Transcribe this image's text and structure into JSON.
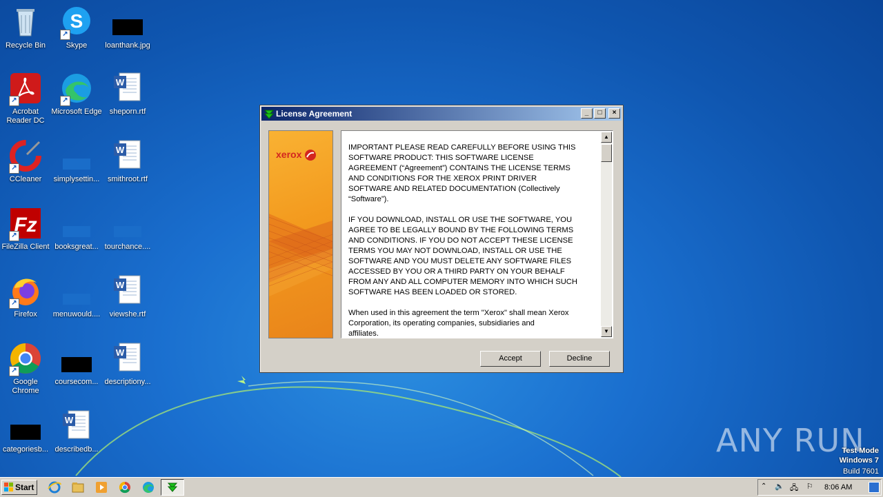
{
  "desktop": {
    "icons": [
      {
        "label": "Recycle Bin"
      },
      {
        "label": "Skype"
      },
      {
        "label": "loanthank.jpg"
      },
      {
        "label": "Acrobat Reader DC"
      },
      {
        "label": "Microsoft Edge"
      },
      {
        "label": "sheporn.rtf"
      },
      {
        "label": "CCleaner"
      },
      {
        "label": "simplysettin..."
      },
      {
        "label": "smithroot.rtf"
      },
      {
        "label": "FileZilla Client"
      },
      {
        "label": "booksgreat..."
      },
      {
        "label": "tourchance...."
      },
      {
        "label": "Firefox"
      },
      {
        "label": "menuwould...."
      },
      {
        "label": "viewshe.rtf"
      },
      {
        "label": "Google Chrome"
      },
      {
        "label": "coursecom..."
      },
      {
        "label": "descriptiony..."
      },
      {
        "label": "categoriesb..."
      },
      {
        "label": "describedb..."
      }
    ]
  },
  "dialog": {
    "title": "License Agreement",
    "minimize": "_",
    "maximize": "□",
    "close": "×",
    "brand": "xerox",
    "license_paragraphs": [
      "IMPORTANT PLEASE READ CAREFULLY BEFORE USING THIS\nSOFTWARE PRODUCT:  THIS SOFTWARE LICENSE\nAGREEMENT (“Agreement”) CONTAINS THE LICENSE TERMS\nAND CONDITIONS FOR THE XEROX PRINT DRIVER\nSOFTWARE AND RELATED DOCUMENTATION (Collectively\n“Software”).",
      "IF YOU DOWNLOAD, INSTALL OR USE THE SOFTWARE, YOU\nAGREE TO BE LEGALLY BOUND BY THE FOLLOWING TERMS\nAND CONDITIONS.  IF YOU DO NOT ACCEPT THESE LICENSE\nTERMS YOU MAY NOT DOWNLOAD, INSTALL OR USE THE\nSOFTWARE AND YOU MUST DELETE ANY SOFTWARE FILES\nACCESSED BY YOU OR A THIRD PARTY ON YOUR BEHALF\nFROM ANY AND ALL COMPUTER MEMORY INTO WHICH SUCH\nSOFTWARE HAS BEEN LOADED OR STORED.",
      "When used in this agreement the term \"Xerox\" shall mean Xerox\nCorporation, its operating companies, subsidiaries and\naffiliates."
    ],
    "accept_label": "Accept",
    "decline_label": "Decline"
  },
  "taskbar": {
    "start_label": "Start",
    "clock": "8:06 AM"
  },
  "watermark": {
    "line1": "Test Mode",
    "line2": "Windows 7",
    "line3": "Build 7601",
    "logo": "ANY RUN"
  }
}
